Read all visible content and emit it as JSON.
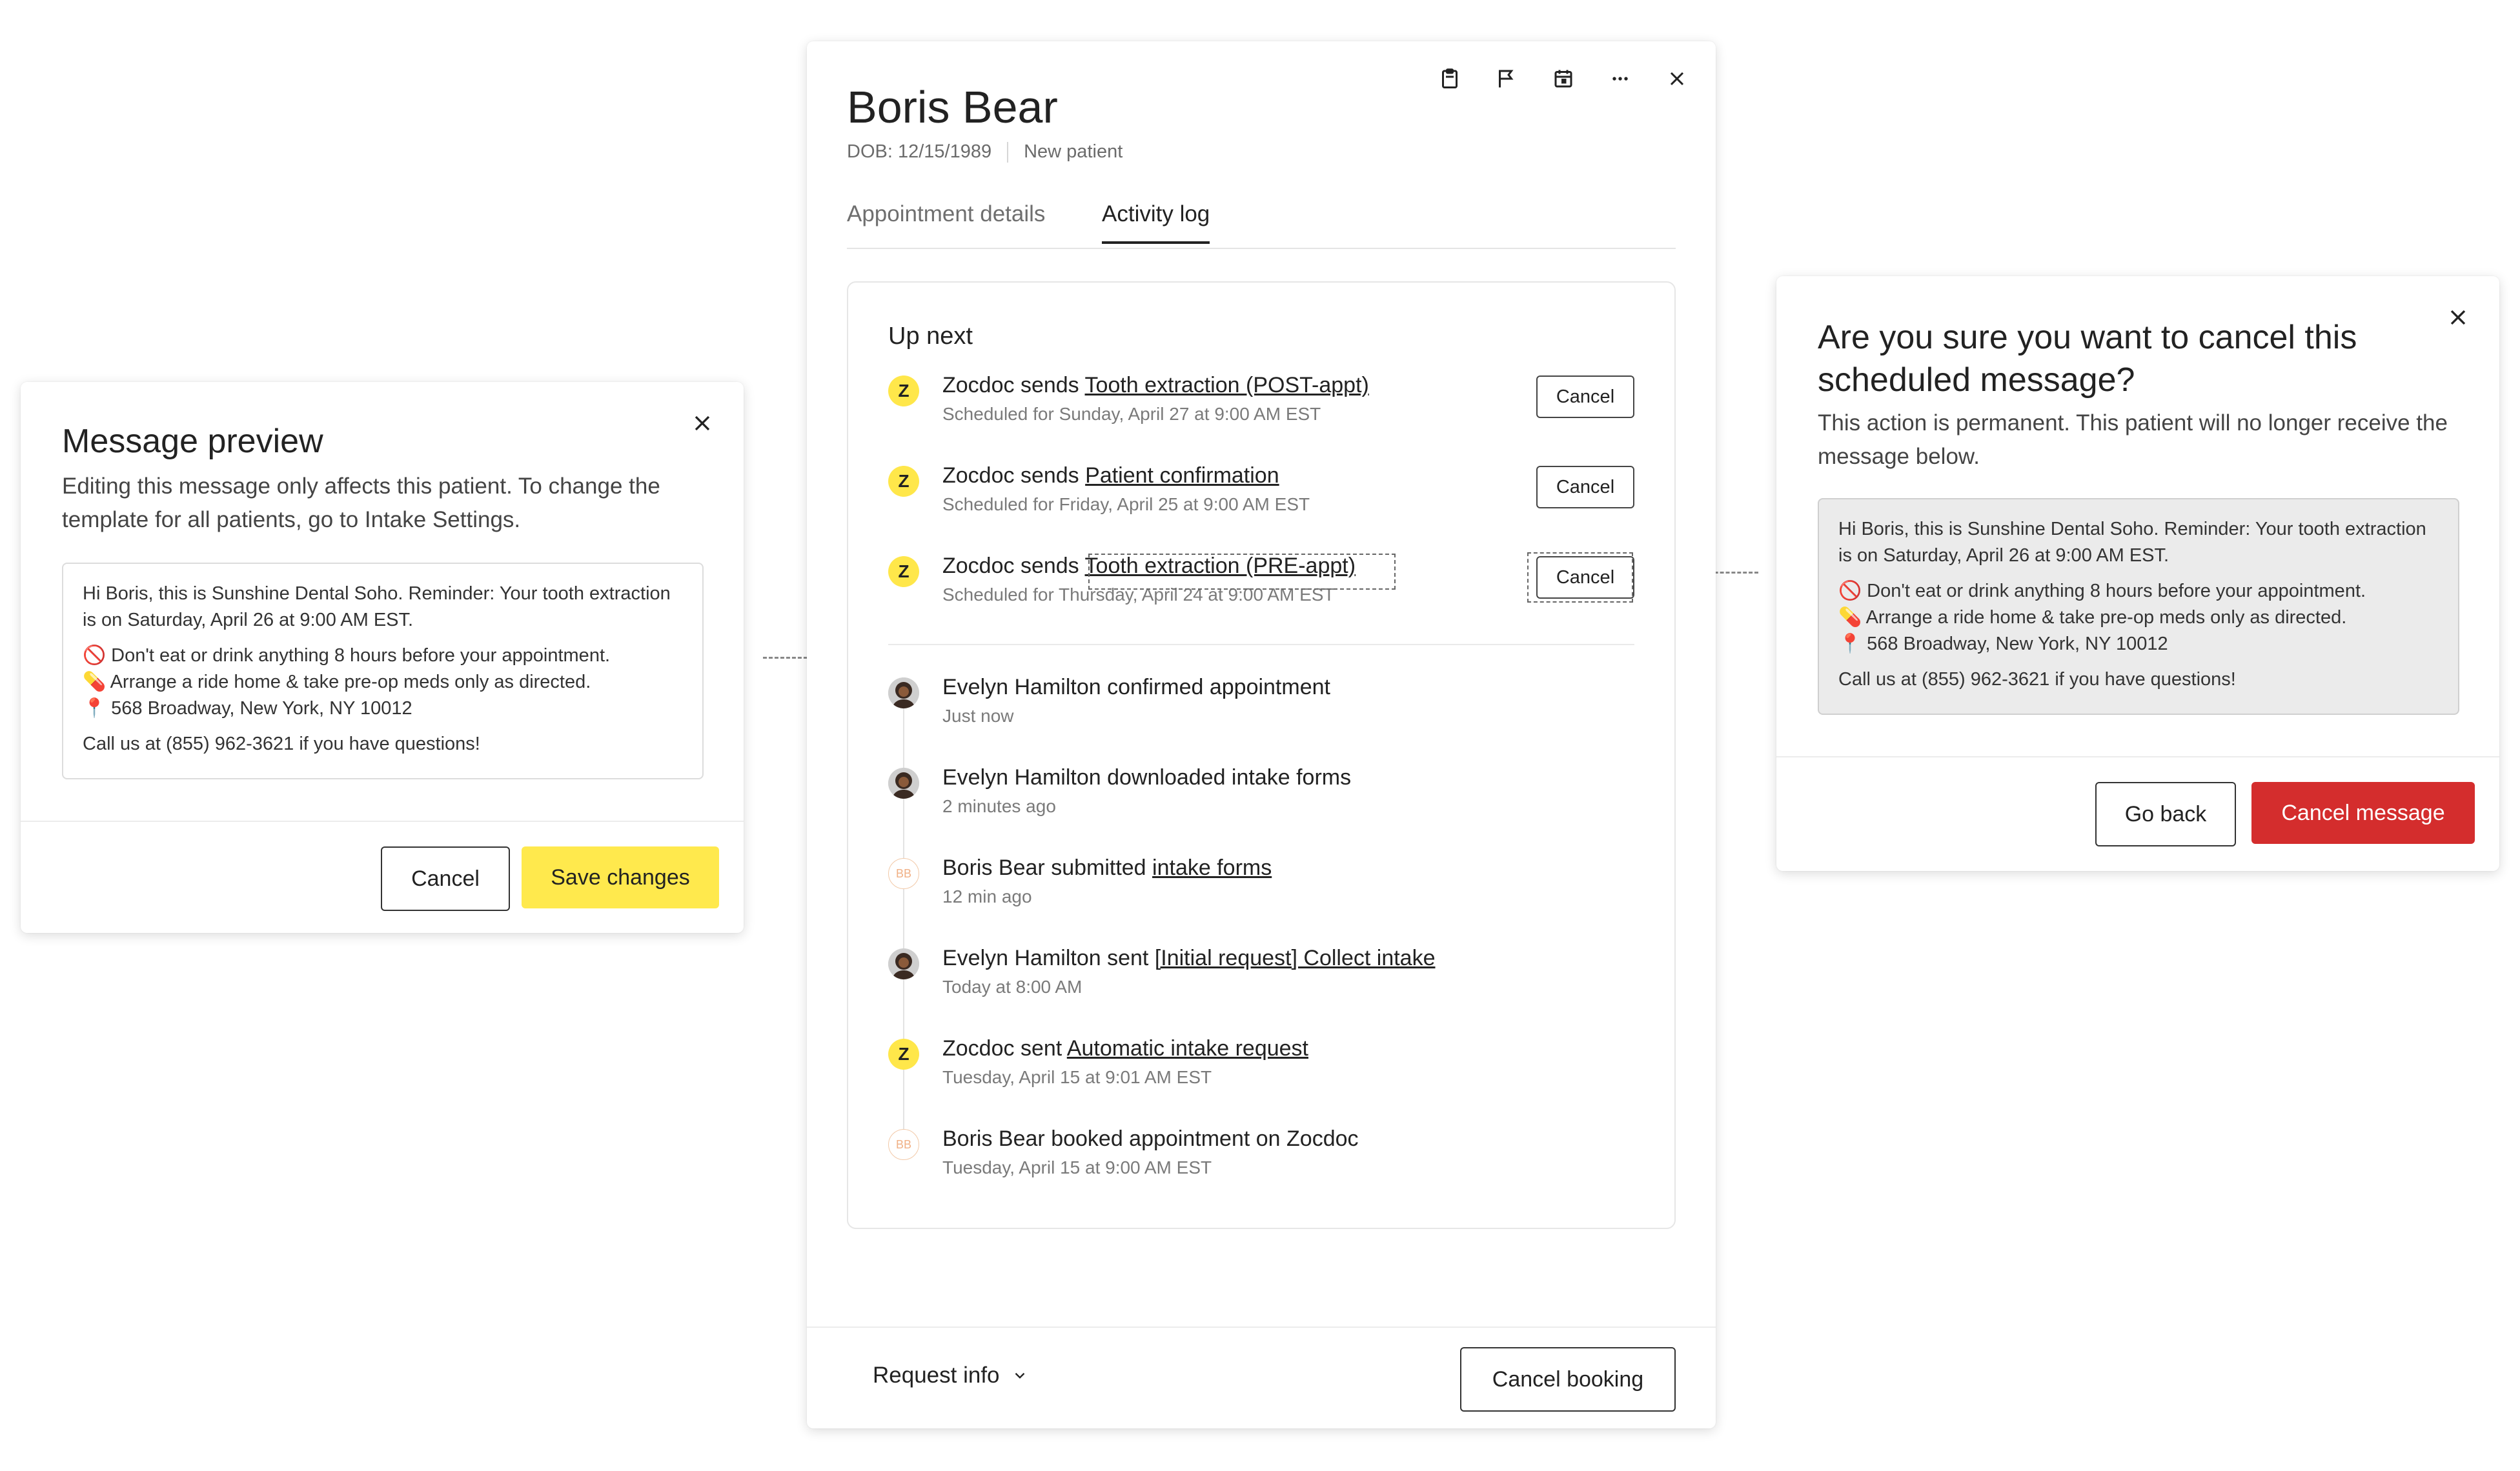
{
  "patient": {
    "name": "Boris Bear",
    "dob": "DOB: 12/15/1989",
    "status": "New patient"
  },
  "tabs": [
    "Appointment details",
    "Activity log"
  ],
  "activity": {
    "up_next_title": "Up next",
    "up_next": [
      {
        "actor": "Zocdoc",
        "verb": "sends",
        "link": "Tooth extraction (POST-appt)",
        "sub": "Scheduled for Sunday, April 27 at 9:00 AM EST",
        "button": "Cancel"
      },
      {
        "actor": "Zocdoc",
        "verb": "sends",
        "link": "Patient confirmation",
        "sub": "Scheduled for Friday, April 25 at 9:00 AM EST",
        "button": "Cancel"
      },
      {
        "actor": "Zocdoc",
        "verb": "sends",
        "link": "Tooth extraction (PRE-appt)",
        "sub": "Scheduled for Thursday, April 24 at 9:00 AM EST",
        "button": "Cancel"
      }
    ],
    "log": [
      {
        "actor": "Evelyn Hamilton",
        "text": "confirmed appointment",
        "link": "",
        "sub": "Just now",
        "icon": "avatar"
      },
      {
        "actor": "Evelyn Hamilton",
        "text": "downloaded intake forms",
        "link": "",
        "sub": "2 minutes ago",
        "icon": "avatar"
      },
      {
        "actor": "Boris Bear",
        "text": "submitted",
        "link": "intake forms",
        "sub": "12 min ago",
        "icon": "BB"
      },
      {
        "actor": "Evelyn Hamilton",
        "text": "sent",
        "link": "[Initial request] Collect intake",
        "sub": "Today at 8:00 AM",
        "icon": "avatar"
      },
      {
        "actor": "Zocdoc",
        "text": "sent",
        "link": "Automatic intake request",
        "sub": "Tuesday, April 15 at 9:01 AM EST",
        "icon": "Z"
      },
      {
        "actor": "Boris Bear",
        "text": "booked appointment on Zocdoc",
        "link": "",
        "sub": "Tuesday, April 15 at 9:00 AM EST",
        "icon": "BB"
      }
    ]
  },
  "footer": {
    "request_info": "Request info",
    "cancel_booking": "Cancel booking"
  },
  "message_preview": {
    "title": "Message preview",
    "body": "Editing this message only affects this patient. To change the template for all patients, go to Intake Settings.",
    "message_lines": [
      "Hi Boris, this is Sunshine Dental Soho. Reminder: Your tooth extraction is on Saturday, April 26 at 9:00 AM EST.",
      "🚫 Don't eat or drink anything 8 hours before your appointment.",
      "💊 Arrange a ride home & take pre-op meds only as directed.",
      "📍 568 Broadway, New York, NY 10012",
      "Call us at (855) 962-3621 if you have questions!"
    ],
    "cancel_label": "Cancel",
    "save_label": "Save changes"
  },
  "cancel_dialog": {
    "title": "Are you sure you want to cancel this scheduled message?",
    "body": "This action is permanent. This patient will no longer receive the message below.",
    "message_lines": [
      "Hi Boris, this is Sunshine Dental Soho. Reminder: Your tooth extraction is on Saturday, April 26 at 9:00 AM EST.",
      "🚫 Don't eat or drink anything 8 hours before your appointment.",
      "💊 Arrange a ride home & take pre-op meds only as directed.",
      "📍 568 Broadway, New York, NY 10012",
      "Call us at (855) 962-3621 if you have questions!"
    ],
    "go_back_label": "Go back",
    "confirm_label": "Cancel message"
  },
  "icons": {
    "toolbar": [
      "clipboard-icon",
      "flag-icon",
      "calendar-icon",
      "more-icon",
      "close-icon"
    ]
  },
  "colors": {
    "zocdoc_yellow": "#ffe74a",
    "save_button": "#ffe94d",
    "danger": "#d42d2d",
    "preview_box_bg": "#ebebeb"
  }
}
